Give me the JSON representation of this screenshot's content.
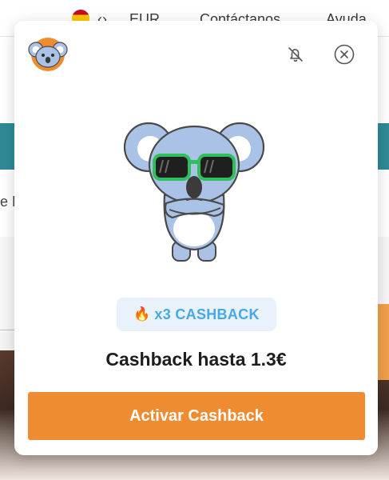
{
  "background": {
    "currency": "EUR",
    "contact_link": "Contáctanos",
    "help_link": "Ayuda",
    "partial_text": "e F"
  },
  "modal": {
    "logo": "koala-logo",
    "icons": {
      "mute": "bell-off-icon",
      "close": "close-circle-icon"
    },
    "badge": {
      "emoji": "🔥",
      "text": "x3 CASHBACK"
    },
    "headline": "Cashback hasta 1.3€",
    "cta_label": "Activar Cashback"
  },
  "colors": {
    "accent": "#ef8c32",
    "badge_bg": "#e9f1fb",
    "badge_text": "#46a9e6",
    "koala_body": "#a9c2e6",
    "glasses": "#2fbf5b"
  }
}
